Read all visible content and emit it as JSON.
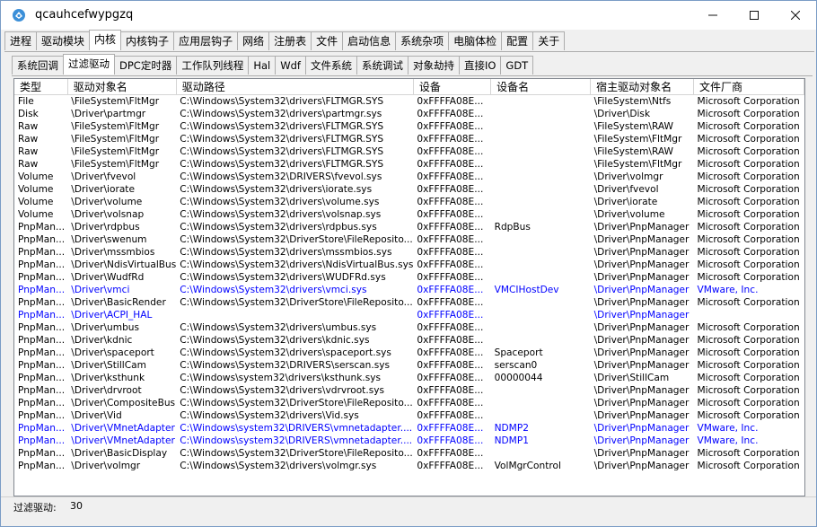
{
  "window": {
    "title": "qcauhcefwypgzq"
  },
  "main_tabs": [
    {
      "label": "进程",
      "active": false
    },
    {
      "label": "驱动模块",
      "active": false
    },
    {
      "label": "内核",
      "active": true
    },
    {
      "label": "内核钩子",
      "active": false
    },
    {
      "label": "应用层钩子",
      "active": false
    },
    {
      "label": "网络",
      "active": false
    },
    {
      "label": "注册表",
      "active": false
    },
    {
      "label": "文件",
      "active": false
    },
    {
      "label": "启动信息",
      "active": false
    },
    {
      "label": "系统杂项",
      "active": false
    },
    {
      "label": "电脑体检",
      "active": false
    },
    {
      "label": "配置",
      "active": false
    },
    {
      "label": "关于",
      "active": false
    }
  ],
  "sub_tabs": [
    {
      "label": "系统回调",
      "active": false
    },
    {
      "label": "过滤驱动",
      "active": true
    },
    {
      "label": "DPC定时器",
      "active": false
    },
    {
      "label": "工作队列线程",
      "active": false
    },
    {
      "label": "Hal",
      "active": false
    },
    {
      "label": "Wdf",
      "active": false
    },
    {
      "label": "文件系统",
      "active": false
    },
    {
      "label": "系统调试",
      "active": false
    },
    {
      "label": "对象劫持",
      "active": false
    },
    {
      "label": "直接IO",
      "active": false
    },
    {
      "label": "GDT",
      "active": false
    }
  ],
  "table": {
    "columns": [
      "类型",
      "驱动对象名",
      "驱动路径",
      "设备",
      "设备名",
      "宿主驱动对象名",
      "文件厂商"
    ],
    "rows": [
      [
        "File",
        "\\FileSystem\\FltMgr",
        "C:\\Windows\\System32\\drivers\\FLTMGR.SYS",
        "0xFFFFA08E...",
        "",
        "\\FileSystem\\Ntfs",
        "Microsoft Corporation"
      ],
      [
        "Disk",
        "\\Driver\\partmgr",
        "C:\\Windows\\System32\\drivers\\partmgr.sys",
        "0xFFFFA08E...",
        "",
        "\\Driver\\Disk",
        "Microsoft Corporation"
      ],
      [
        "Raw",
        "\\FileSystem\\FltMgr",
        "C:\\Windows\\System32\\drivers\\FLTMGR.SYS",
        "0xFFFFA08E...",
        "",
        "\\FileSystem\\RAW",
        "Microsoft Corporation"
      ],
      [
        "Raw",
        "\\FileSystem\\FltMgr",
        "C:\\Windows\\System32\\drivers\\FLTMGR.SYS",
        "0xFFFFA08E...",
        "",
        "\\FileSystem\\FltMgr",
        "Microsoft Corporation"
      ],
      [
        "Raw",
        "\\FileSystem\\FltMgr",
        "C:\\Windows\\System32\\drivers\\FLTMGR.SYS",
        "0xFFFFA08E...",
        "",
        "\\FileSystem\\RAW",
        "Microsoft Corporation"
      ],
      [
        "Raw",
        "\\FileSystem\\FltMgr",
        "C:\\Windows\\System32\\drivers\\FLTMGR.SYS",
        "0xFFFFA08E...",
        "",
        "\\FileSystem\\FltMgr",
        "Microsoft Corporation"
      ],
      [
        "Volume",
        "\\Driver\\fvevol",
        "C:\\Windows\\System32\\DRIVERS\\fvevol.sys",
        "0xFFFFA08E...",
        "",
        "\\Driver\\volmgr",
        "Microsoft Corporation"
      ],
      [
        "Volume",
        "\\Driver\\iorate",
        "C:\\Windows\\System32\\drivers\\iorate.sys",
        "0xFFFFA08E...",
        "",
        "\\Driver\\fvevol",
        "Microsoft Corporation"
      ],
      [
        "Volume",
        "\\Driver\\volume",
        "C:\\Windows\\System32\\drivers\\volume.sys",
        "0xFFFFA08E...",
        "",
        "\\Driver\\iorate",
        "Microsoft Corporation"
      ],
      [
        "Volume",
        "\\Driver\\volsnap",
        "C:\\Windows\\System32\\drivers\\volsnap.sys",
        "0xFFFFA08E...",
        "",
        "\\Driver\\volume",
        "Microsoft Corporation"
      ],
      [
        "PnpMan...",
        "\\Driver\\rdpbus",
        "C:\\Windows\\System32\\drivers\\rdpbus.sys",
        "0xFFFFA08E...",
        "RdpBus",
        "\\Driver\\PnpManager",
        "Microsoft Corporation"
      ],
      [
        "PnpMan...",
        "\\Driver\\swenum",
        "C:\\Windows\\System32\\DriverStore\\FileReposito...",
        "0xFFFFA08E...",
        "",
        "\\Driver\\PnpManager",
        "Microsoft Corporation"
      ],
      [
        "PnpMan...",
        "\\Driver\\mssmbios",
        "C:\\Windows\\System32\\drivers\\mssmbios.sys",
        "0xFFFFA08E...",
        "",
        "\\Driver\\PnpManager",
        "Microsoft Corporation"
      ],
      [
        "PnpMan...",
        "\\Driver\\NdisVirtualBus",
        "C:\\Windows\\System32\\drivers\\NdisVirtualBus.sys",
        "0xFFFFA08E...",
        "",
        "\\Driver\\PnpManager",
        "Microsoft Corporation"
      ],
      [
        "PnpMan...",
        "\\Driver\\WudfRd",
        "C:\\Windows\\System32\\drivers\\WUDFRd.sys",
        "0xFFFFA08E...",
        "",
        "\\Driver\\PnpManager",
        "Microsoft Corporation"
      ],
      [
        "PnpMan...",
        "\\Driver\\vmci",
        "C:\\Windows\\System32\\drivers\\vmci.sys",
        "0xFFFFA08E...",
        "VMCIHostDev",
        "\\Driver\\PnpManager",
        "VMware, Inc."
      ],
      [
        "PnpMan...",
        "\\Driver\\BasicRender",
        "C:\\Windows\\System32\\DriverStore\\FileReposito...",
        "0xFFFFA08E...",
        "",
        "\\Driver\\PnpManager",
        "Microsoft Corporation"
      ],
      [
        "PnpMan...",
        "\\Driver\\ACPI_HAL",
        "",
        "0xFFFFA08E...",
        "",
        "\\Driver\\PnpManager",
        ""
      ],
      [
        "PnpMan...",
        "\\Driver\\umbus",
        "C:\\Windows\\System32\\drivers\\umbus.sys",
        "0xFFFFA08E...",
        "",
        "\\Driver\\PnpManager",
        "Microsoft Corporation"
      ],
      [
        "PnpMan...",
        "\\Driver\\kdnic",
        "C:\\Windows\\System32\\drivers\\kdnic.sys",
        "0xFFFFA08E...",
        "",
        "\\Driver\\PnpManager",
        "Microsoft Corporation"
      ],
      [
        "PnpMan...",
        "\\Driver\\spaceport",
        "C:\\Windows\\System32\\drivers\\spaceport.sys",
        "0xFFFFA08E...",
        "Spaceport",
        "\\Driver\\PnpManager",
        "Microsoft Corporation"
      ],
      [
        "PnpMan...",
        "\\Driver\\StillCam",
        "C:\\Windows\\System32\\DRIVERS\\serscan.sys",
        "0xFFFFA08E...",
        "serscan0",
        "\\Driver\\PnpManager",
        "Microsoft Corporation"
      ],
      [
        "PnpMan...",
        "\\Driver\\ksthunk",
        "C:\\Windows\\system32\\drivers\\ksthunk.sys",
        "0xFFFFA08E...",
        "00000044",
        "\\Driver\\StillCam",
        "Microsoft Corporation"
      ],
      [
        "PnpMan...",
        "\\Driver\\drvroot",
        "C:\\Windows\\System32\\drivers\\vdrvroot.sys",
        "0xFFFFA08E...",
        "",
        "\\Driver\\PnpManager",
        "Microsoft Corporation"
      ],
      [
        "PnpMan...",
        "\\Driver\\CompositeBus",
        "C:\\Windows\\System32\\DriverStore\\FileReposito...",
        "0xFFFFA08E...",
        "",
        "\\Driver\\PnpManager",
        "Microsoft Corporation"
      ],
      [
        "PnpMan...",
        "\\Driver\\Vid",
        "C:\\Windows\\System32\\drivers\\Vid.sys",
        "0xFFFFA08E...",
        "",
        "\\Driver\\PnpManager",
        "Microsoft Corporation"
      ],
      [
        "PnpMan...",
        "\\Driver\\VMnetAdapter",
        "C:\\Windows\\system32\\DRIVERS\\vmnetadapter....",
        "0xFFFFA08E...",
        "NDMP2",
        "\\Driver\\PnpManager",
        "VMware, Inc."
      ],
      [
        "PnpMan...",
        "\\Driver\\VMnetAdapter",
        "C:\\Windows\\system32\\DRIVERS\\vmnetadapter....",
        "0xFFFFA08E...",
        "NDMP1",
        "\\Driver\\PnpManager",
        "VMware, Inc."
      ],
      [
        "PnpMan...",
        "\\Driver\\BasicDisplay",
        "C:\\Windows\\System32\\DriverStore\\FileReposito...",
        "0xFFFFA08E...",
        "",
        "\\Driver\\PnpManager",
        "Microsoft Corporation"
      ],
      [
        "PnpMan...",
        "\\Driver\\volmgr",
        "C:\\Windows\\System32\\drivers\\volmgr.sys",
        "0xFFFFA08E...",
        "VolMgrControl",
        "\\Driver\\PnpManager",
        "Microsoft Corporation"
      ]
    ],
    "highlight_rows": [
      15,
      17,
      26,
      27
    ],
    "highlight_color": "#0000ff"
  },
  "status": {
    "label": "过滤驱动:",
    "count": "30"
  },
  "icons": {
    "app": "app-logo-icon",
    "minimize": "minimize-icon",
    "maximize": "maximize-icon",
    "close": "close-icon"
  }
}
